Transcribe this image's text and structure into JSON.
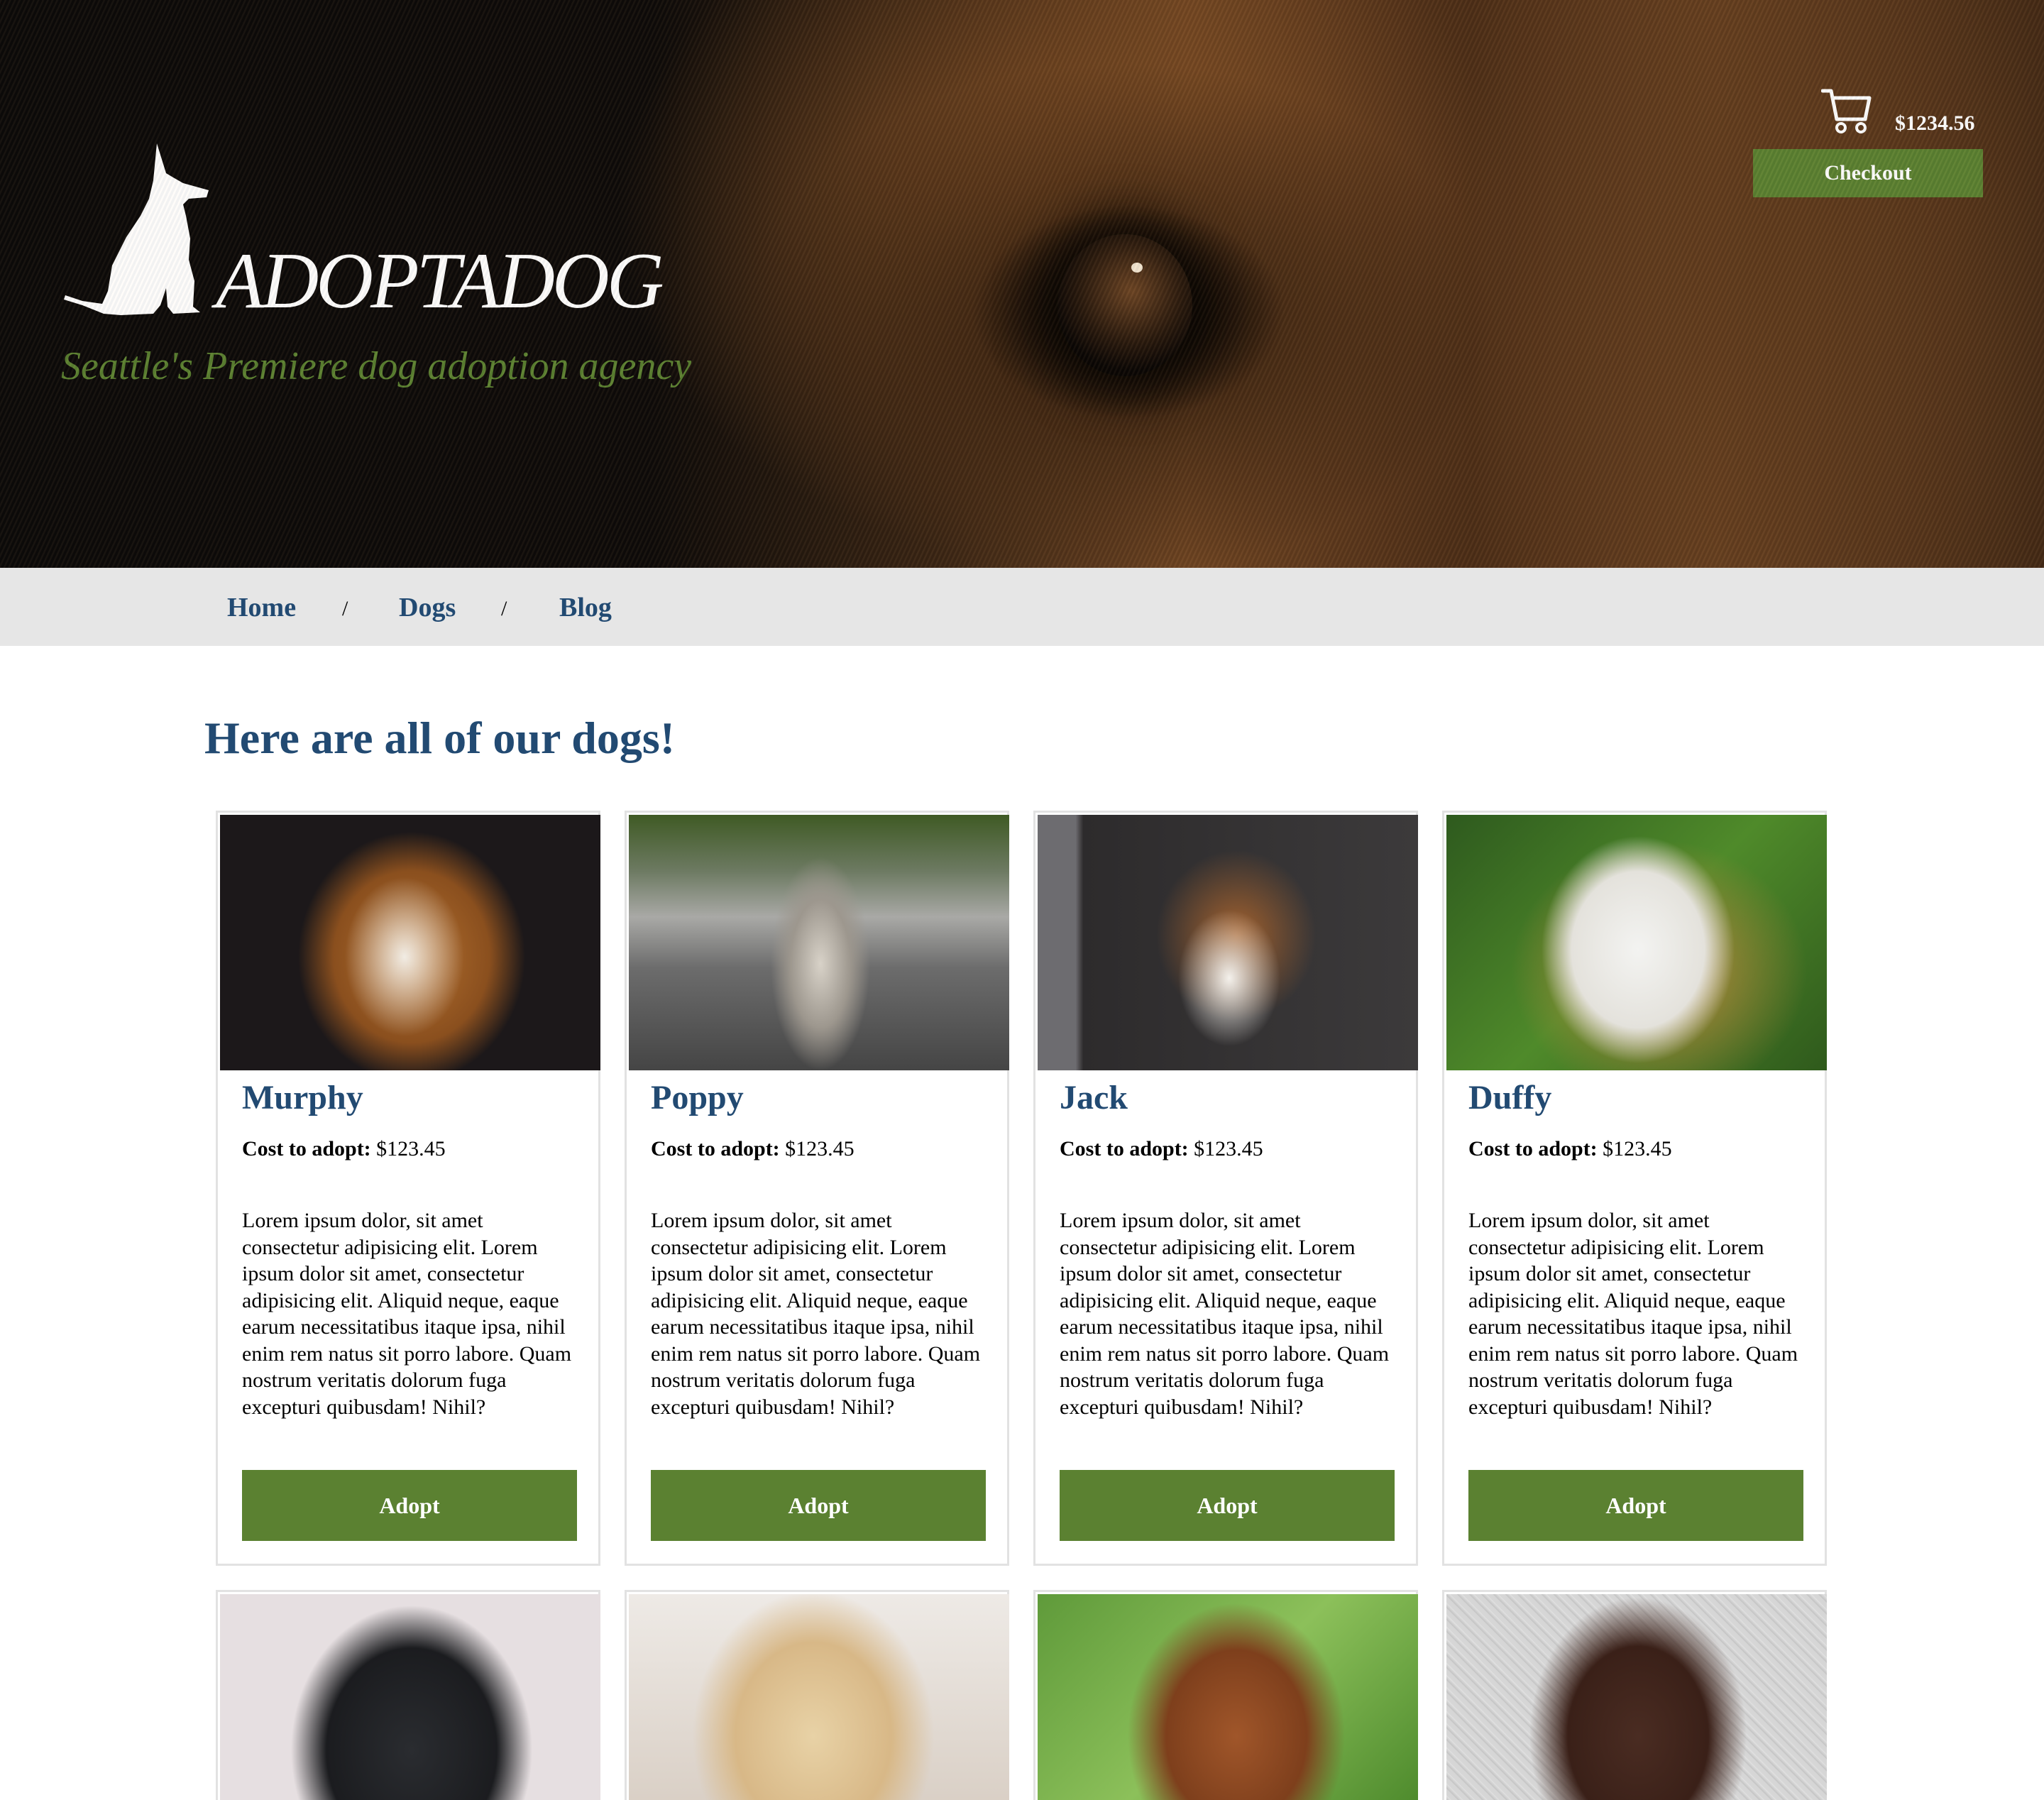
{
  "header": {
    "brand": "ADOPTADOG",
    "tagline": "Seattle's Premiere dog adoption agency",
    "cart_total": "$1234.56",
    "checkout_label": "Checkout"
  },
  "nav": {
    "items": [
      "Home",
      "Dogs",
      "Blog"
    ],
    "separator": "/"
  },
  "main": {
    "heading": "Here are all of our dogs!",
    "cost_label": "Cost to adopt:",
    "adopt_label": "Adopt",
    "dogs": [
      {
        "name": "Murphy",
        "cost": "$123.45",
        "description": "Lorem ipsum dolor, sit amet consectetur adipisicing elit. Lorem ipsum dolor sit amet, consectetur adipisicing elit. Aliquid neque, eaque earum necessitatibus itaque ipsa, nihil enim rem natus sit porro labore. Quam nostrum veritatis dolorum fuga excepturi quibusdam! Nihil?"
      },
      {
        "name": "Poppy",
        "cost": "$123.45",
        "description": "Lorem ipsum dolor, sit amet consectetur adipisicing elit. Lorem ipsum dolor sit amet, consectetur adipisicing elit. Aliquid neque, eaque earum necessitatibus itaque ipsa, nihil enim rem natus sit porro labore. Quam nostrum veritatis dolorum fuga excepturi quibusdam! Nihil?"
      },
      {
        "name": "Jack",
        "cost": "$123.45",
        "description": "Lorem ipsum dolor, sit amet consectetur adipisicing elit. Lorem ipsum dolor sit amet, consectetur adipisicing elit. Aliquid neque, eaque earum necessitatibus itaque ipsa, nihil enim rem natus sit porro labore. Quam nostrum veritatis dolorum fuga excepturi quibusdam! Nihil?"
      },
      {
        "name": "Duffy",
        "cost": "$123.45",
        "description": "Lorem ipsum dolor, sit amet consectetur adipisicing elit. Lorem ipsum dolor sit amet, consectetur adipisicing elit. Aliquid neque, eaque earum necessitatibus itaque ipsa, nihil enim rem natus sit porro labore. Quam nostrum veritatis dolorum fuga excepturi quibusdam! Nihil?"
      }
    ]
  },
  "colors": {
    "accent_green": "#5b8131",
    "heading_blue": "#224a72",
    "nav_bg": "#e6e6e6"
  }
}
